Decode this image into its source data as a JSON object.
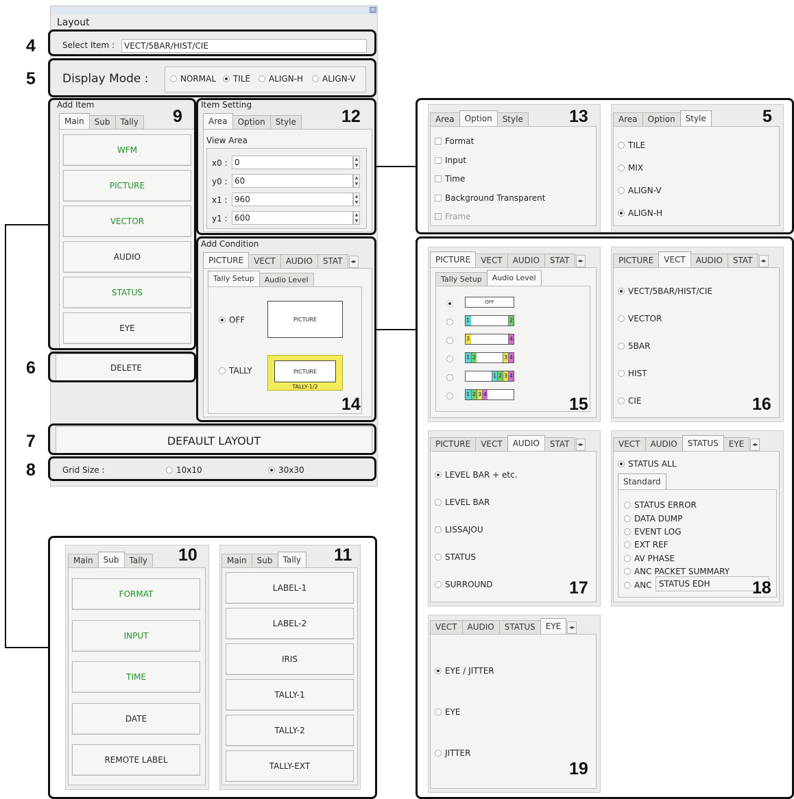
{
  "window": {
    "title": "Layout"
  },
  "select_item": {
    "label": "Select Item :",
    "value": "VECT/5BAR/HIST/CIE"
  },
  "display_mode": {
    "label": "Display Mode :",
    "options": [
      "NORMAL",
      "TILE",
      "ALIGN-H",
      "ALIGN-V"
    ],
    "selected": "TILE"
  },
  "add_item": {
    "title": "Add Item",
    "tabs": [
      "Main",
      "Sub",
      "Tally"
    ],
    "buttons": [
      "WFM",
      "PICTURE",
      "VECTOR",
      "AUDIO",
      "STATUS",
      "EYE"
    ]
  },
  "delete_label": "DELETE",
  "item_setting": {
    "title": "Item Setting",
    "tabs": [
      "Area",
      "Option",
      "Style"
    ],
    "view_area": "View Area",
    "fields": [
      {
        "label": "x0 :",
        "value": "0"
      },
      {
        "label": "y0 :",
        "value": "60"
      },
      {
        "label": "x1 :",
        "value": "960"
      },
      {
        "label": "y1 :",
        "value": "600"
      }
    ]
  },
  "add_condition": {
    "title": "Add Condition",
    "tabs": [
      "PICTURE",
      "VECT",
      "AUDIO",
      "STAT"
    ],
    "subtabs": [
      "Tally Setup",
      "Audio Level"
    ],
    "off_label": "OFF",
    "tally_label": "TALLY",
    "preview_label": "PICTURE",
    "tally_preview_label": "PICTURE",
    "tally_caption": "TALLY-1/2"
  },
  "default_layout_label": "DEFAULT LAYOUT",
  "grid_size": {
    "label": "Grid Size :",
    "options": [
      "10x10",
      "30x30"
    ],
    "selected": "30x30"
  },
  "callouts": {
    "n4": "4",
    "n5": "5",
    "n6": "6",
    "n7": "7",
    "n8": "8",
    "n9": "9",
    "n10": "10",
    "n11": "11",
    "n12": "12",
    "n13": "13",
    "n5b": "5",
    "n14": "14",
    "n15": "15",
    "n16": "16",
    "n17": "17",
    "n18": "18",
    "n19": "19"
  },
  "panel13": {
    "tabs": [
      "Area",
      "Option",
      "Style"
    ],
    "checks": [
      "Format",
      "Input",
      "Time",
      "Background Transparent",
      "Frame"
    ]
  },
  "panel5b": {
    "tabs": [
      "Area",
      "Option",
      "Style"
    ],
    "options": [
      "TILE",
      "MIX",
      "ALIGN-V",
      "ALIGN-H"
    ],
    "selected": "ALIGN-H"
  },
  "panel15": {
    "tabs": [
      "PICTURE",
      "VECT",
      "AUDIO",
      "STAT"
    ],
    "subtabs": [
      "Tally Setup",
      "Audio Level"
    ],
    "off_label": "OFF",
    "rows": [
      [
        {
          "t": "1",
          "c": "#5fd3d3"
        },
        {
          "t": "2",
          "c": "#6ccf6c"
        }
      ],
      [
        {
          "t": "3",
          "c": "#e6e24a"
        },
        {
          "t": "4",
          "c": "#d66ad6"
        }
      ],
      [
        {
          "t": "1",
          "c": "#5fd3d3"
        },
        {
          "t": "2",
          "c": "#6ccf6c"
        },
        {
          "t": "3",
          "c": "#e6e24a"
        },
        {
          "t": "4",
          "c": "#d66ad6"
        }
      ],
      [
        {
          "t": "1",
          "c": "#5fd3d3"
        },
        {
          "t": "2",
          "c": "#6ccf6c"
        },
        {
          "t": "3",
          "c": "#e6e24a"
        },
        {
          "t": "4",
          "c": "#d66ad6"
        }
      ],
      [
        {
          "t": "1",
          "c": "#5fd3d3"
        },
        {
          "t": "2",
          "c": "#6ccf6c"
        },
        {
          "t": "3",
          "c": "#e6e24a"
        },
        {
          "t": "4",
          "c": "#d66ad6"
        }
      ]
    ]
  },
  "panel16": {
    "tabs": [
      "PICTURE",
      "VECT",
      "AUDIO",
      "STAT"
    ],
    "options": [
      "VECT/5BAR/HIST/CIE",
      "VECTOR",
      "5BAR",
      "HIST",
      "CIE"
    ],
    "selected": "VECT/5BAR/HIST/CIE"
  },
  "panel17": {
    "tabs": [
      "PICTURE",
      "VECT",
      "AUDIO",
      "STAT"
    ],
    "options": [
      "LEVEL BAR + etc.",
      "LEVEL BAR",
      "LISSAJOU",
      "STATUS",
      "SURROUND"
    ],
    "selected": "LEVEL BAR + etc."
  },
  "panel18": {
    "tabs": [
      "VECT",
      "AUDIO",
      "STATUS",
      "EYE"
    ],
    "all_label": "STATUS ALL",
    "subtab": "Standard",
    "options": [
      "STATUS ERROR",
      "DATA DUMP",
      "EVENT LOG",
      "EXT REF",
      "AV PHASE",
      "ANC PACKET SUMMARY",
      "ANC"
    ],
    "overlay": "STATUS EDH"
  },
  "panel19": {
    "tabs": [
      "VECT",
      "AUDIO",
      "STATUS",
      "EYE"
    ],
    "options": [
      "EYE / JITTER",
      "EYE",
      "JITTER"
    ],
    "selected": "EYE / JITTER"
  },
  "panel10": {
    "tabs": [
      "Main",
      "Sub",
      "Tally"
    ],
    "buttons": [
      "FORMAT",
      "INPUT",
      "TIME",
      "DATE",
      "REMOTE LABEL"
    ]
  },
  "panel11": {
    "tabs": [
      "Main",
      "Sub",
      "Tally"
    ],
    "buttons": [
      "LABEL-1",
      "LABEL-2",
      "IRIS",
      "TALLY-1",
      "TALLY-2",
      "TALLY-EXT"
    ]
  }
}
